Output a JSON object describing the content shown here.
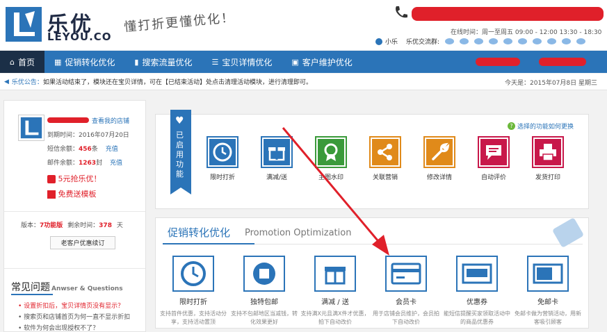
{
  "brand": {
    "logo_cn": "乐优",
    "logo_en": "LEYOU.CO",
    "slogan": "懂打折更懂优化！"
  },
  "header": {
    "hours": "在线时间：周一至周五  09:00 - 12:00  13:30 - 18:30",
    "qq_name": "小乐",
    "qq_group_label": "乐优交流群:"
  },
  "nav": {
    "items": [
      {
        "label": "首页",
        "icon": "home-icon"
      },
      {
        "label": "促销转化优化",
        "icon": "calendar-icon"
      },
      {
        "label": "搜索流量优化",
        "icon": "bar-chart-icon"
      },
      {
        "label": "宝贝详情优化",
        "icon": "list-icon"
      },
      {
        "label": "客户维护优化",
        "icon": "cart-icon"
      }
    ]
  },
  "notice": {
    "label": "乐优公告：",
    "text": "如果活动结束了，模块还在宝贝详情，可在【已结束活动】处点击清理活动模块，进行清理即可。",
    "today": "今天是：2015年07月8日  星期三"
  },
  "shop": {
    "view_link": "查看我的店铺",
    "expire": "到期时间：2016年07月20日",
    "sms_label": "短信余额：",
    "sms_value": "456",
    "sms_unit": "条",
    "mail_label": "邮件余额：",
    "mail_value": "1263",
    "mail_unit": "封",
    "recharge": "充值",
    "promo1": "5元抢乐优！",
    "promo2": "免费送模板"
  },
  "version": {
    "ver_label": "版本：",
    "ver_value": "7功能版",
    "days_label": "剩余时间：",
    "days_value": "378",
    "days_unit": "天",
    "renew_button": "老客户优惠续订"
  },
  "faq": {
    "title": "常见问题",
    "title_en": "Anwser & Questions",
    "q1": "设置折扣后，宝贝详情页没有显示？",
    "q2": "搜索页和店铺首页为何一直不显示折扣",
    "q3": "软件为何会出现授权不了？"
  },
  "enabled": {
    "ribbon": "已启用功能",
    "howto": "选择的功能如何更换",
    "features": [
      "限时打折",
      "满减/送",
      "主图水印",
      "关联营销",
      "修改详情",
      "自动评价",
      "发货打印"
    ]
  },
  "promo": {
    "title": "促销转化优化",
    "title_en": "Promotion Optimization",
    "features": [
      {
        "name": "限时打折",
        "desc": "支持首件优惠，支持活动分享，支持活动置顶"
      },
      {
        "name": "独特包邮",
        "desc": "支持不包邮地区当减钱，转化效果更好"
      },
      {
        "name": "满减 / 送",
        "desc": "支持满X元且满X件才优惠，拍下自动改价"
      },
      {
        "name": "会员卡",
        "desc": "用于店铺会员维护，会员拍下自动改价"
      },
      {
        "name": "优惠券",
        "desc": "能短信提醒买家领取活动中的商品优惠券"
      },
      {
        "name": "免邮卡",
        "desc": "免邮卡做为营销活动，用新客吸引顾客"
      }
    ]
  },
  "colors": {
    "primary": "#2b74b8",
    "nav_active": "#1b2f47",
    "accent_red": "#e0202a"
  }
}
